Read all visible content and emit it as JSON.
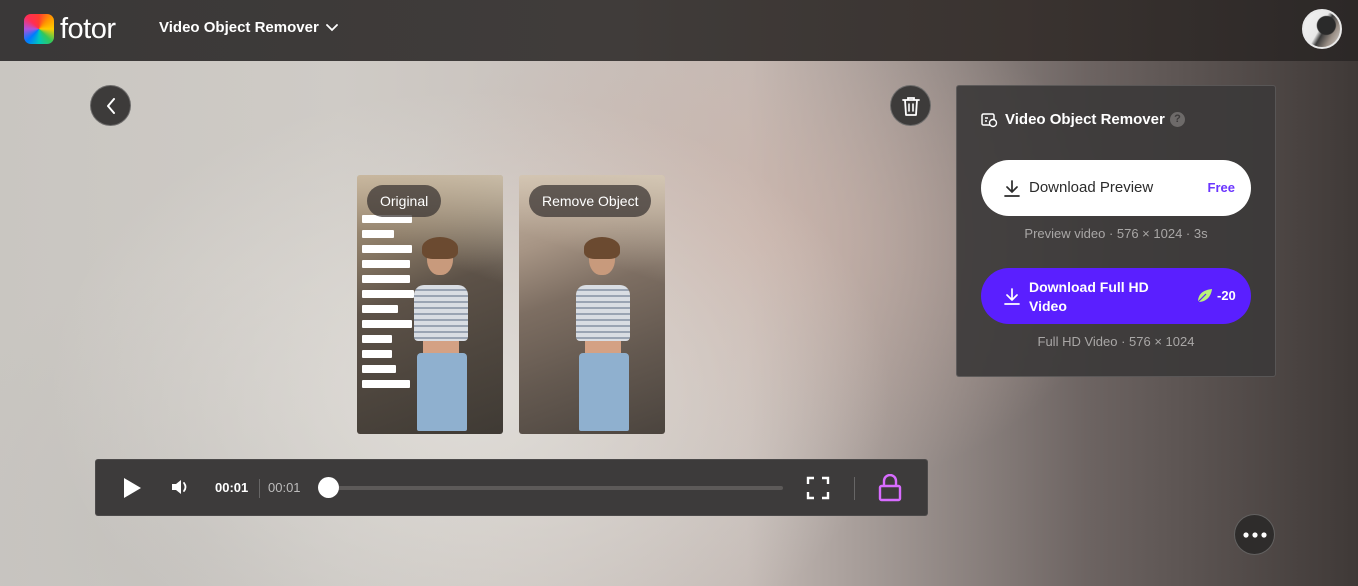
{
  "header": {
    "logo_text": "fotor",
    "product_menu_label": "Video Object Remover"
  },
  "previews": {
    "original_label": "Original",
    "removed_label": "Remove Object"
  },
  "player": {
    "current_time": "00:01",
    "total_time": "00:01",
    "progress": 0
  },
  "panel": {
    "title": "Video Object Remover",
    "help_glyph": "?",
    "download_preview_label": "Download Preview",
    "download_preview_badge": "Free",
    "preview_info": "Preview video · 576 × 1024 · 3s",
    "download_full_label": "Download Full HD Video",
    "download_full_cost": "-20",
    "full_info": "Full HD Video · 576 × 1024"
  },
  "colors": {
    "accent_purple": "#5a1fff",
    "free_text": "#6b35ff",
    "lock_pink": "#d86cff"
  },
  "icons": [
    "chevron-down-icon",
    "avatar",
    "chevron-left-icon",
    "trash-icon",
    "play-icon",
    "volume-icon",
    "fullscreen-icon",
    "lock-icon",
    "help-icon",
    "download-icon",
    "leaf-icon",
    "more-icon"
  ]
}
